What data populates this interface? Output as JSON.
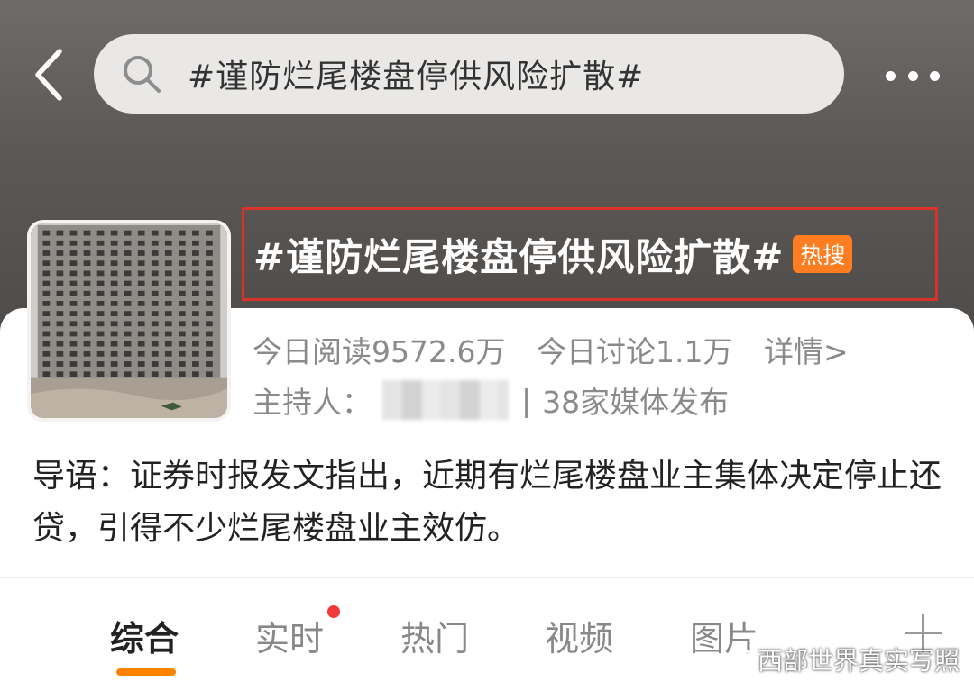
{
  "search": {
    "query": "#谨防烂尾楼盘停供风险扩散#"
  },
  "topic": {
    "title": "#谨防烂尾楼盘停供风险扩散#",
    "badge": "热搜",
    "stats": {
      "read": "今日阅读9572.6万",
      "discuss": "今日讨论1.1万",
      "detail_link": "详情>"
    },
    "host_label": "主持人：",
    "media_count": "38家媒体发布",
    "intro": "导语：证券时报发文指出，近期有烂尾楼盘业主集体决定停止还贷，引得不少烂尾楼盘业主效仿。"
  },
  "tabs": [
    {
      "label": "综合",
      "active": true
    },
    {
      "label": "实时",
      "has_dot": true
    },
    {
      "label": "热门"
    },
    {
      "label": "视频"
    },
    {
      "label": "图片"
    }
  ],
  "watermark": "西部世界真实写照",
  "colors": {
    "accent": "#ff8200",
    "hot_badge": "#ff7d21",
    "highlight_frame": "#d8322b",
    "notification_dot": "#f33a3a"
  },
  "icons": {
    "back": "chevron-left-icon",
    "search": "search-icon",
    "more": "more-dots-icon",
    "add_tab": "plus-icon",
    "watermark_logo": "weibo-logo-icon"
  }
}
